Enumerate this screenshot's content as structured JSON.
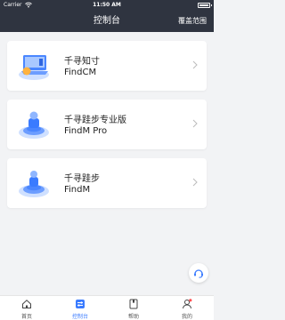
{
  "status_bar": {
    "carrier": "Carrier",
    "time": "11:50 AM"
  },
  "header": {
    "title": "控制台",
    "action": "覆盖范围"
  },
  "cards": [
    {
      "name": "千寻知寸",
      "sub": "FindCM"
    },
    {
      "name": "千寻跬步专业版",
      "sub": "FindM Pro"
    },
    {
      "name": "千寻跬步",
      "sub": "FindM"
    }
  ],
  "tabs": [
    {
      "label": "首页"
    },
    {
      "label": "控制台"
    },
    {
      "label": "帮助"
    },
    {
      "label": "我的"
    }
  ],
  "colors": {
    "accent": "#3a7bff",
    "nav_bg": "#2f3440",
    "badge": "#ff4d4f"
  }
}
